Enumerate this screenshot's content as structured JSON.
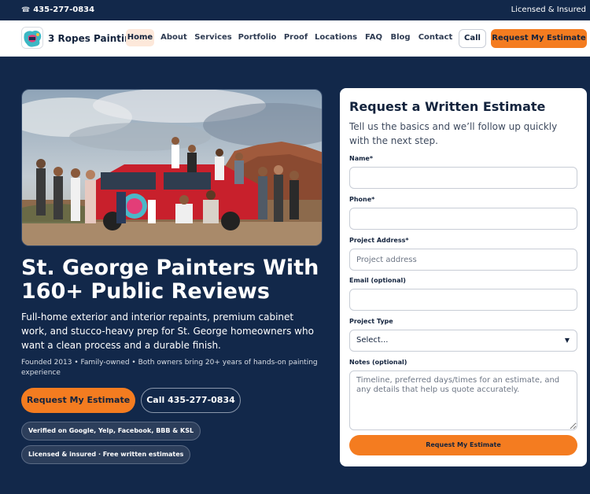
{
  "topbar": {
    "phone_icon": "phone-icon",
    "phone": "435-277-0834",
    "licensed": "Licensed & Insured"
  },
  "nav": {
    "brand": "3 Ropes Painting",
    "items": [
      "Home",
      "About",
      "Services",
      "Portfolio",
      "Proof",
      "Locations",
      "FAQ",
      "Blog",
      "Contact"
    ],
    "active": "Home",
    "call_label": "Call",
    "estimate_label": "Request My Estimate"
  },
  "hero": {
    "headline": "St. George Painters With 160+ Public Reviews",
    "lead": "Full-home exterior and interior repaints, premium cabinet work, and stucco-heavy prep for St. George homeowners who want a clean process and a durable finish.",
    "small": "Founded 2013 • Family-owned • Both owners bring 20+ years of hands-on painting experience",
    "cta_primary": "Request My Estimate",
    "cta_secondary": "Call 435-277-0834",
    "badges": [
      "Verified on Google, Yelp, Facebook, BBB & KSL",
      "Licensed & insured · Free written estimates"
    ]
  },
  "form": {
    "title": "Request a Written Estimate",
    "subtitle": "Tell us the basics and we’ll follow up quickly with the next step.",
    "name_label": "Name*",
    "name_value": "",
    "phone_label": "Phone*",
    "phone_value": "",
    "address_label": "Project Address*",
    "address_placeholder": "Project address",
    "email_label": "Email (optional)",
    "email_value": "",
    "type_label": "Project Type",
    "type_value": "Select...",
    "notes_label": "Notes (optional)",
    "notes_placeholder": "Timeline, preferred days/times for an estimate, and any details that help us quote accurately.",
    "submit_label": "Request My Estimate"
  },
  "colors": {
    "navy": "#12284a",
    "accent": "#f47c20"
  }
}
